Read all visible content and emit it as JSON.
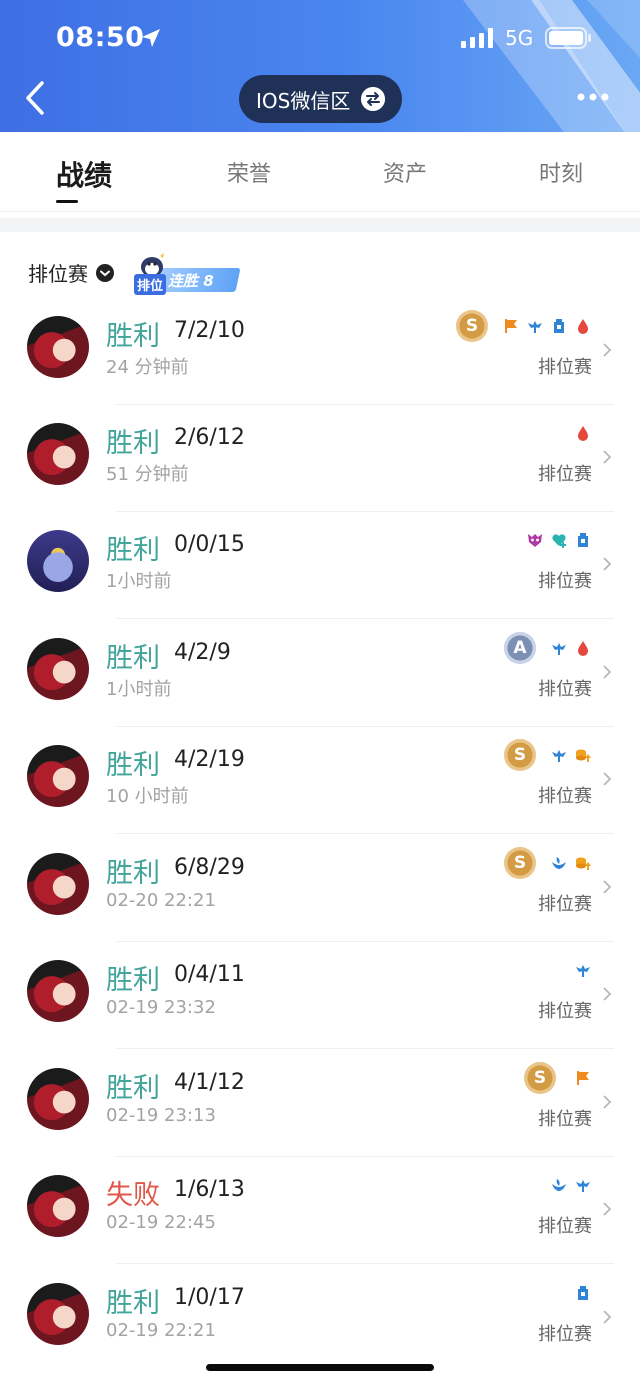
{
  "status_bar": {
    "time": "08:50",
    "network": "5G"
  },
  "nav": {
    "server_label": "IOS微信区"
  },
  "tabs": [
    {
      "label": "战绩",
      "active": true
    },
    {
      "label": "荣誉",
      "active": false
    },
    {
      "label": "资产",
      "active": false
    },
    {
      "label": "时刻",
      "active": false
    }
  ],
  "section": {
    "title": "排位赛",
    "badge_rank": "排位",
    "badge_streak": "连胜 8"
  },
  "matches": [
    {
      "result": "胜利",
      "kda": "7/2/10",
      "time": "24 分钟前",
      "mode": "排位赛"
    },
    {
      "result": "胜利",
      "kda": "2/6/12",
      "time": "51 分钟前",
      "mode": "排位赛"
    },
    {
      "result": "胜利",
      "kda": "0/0/15",
      "time": "1小时前",
      "mode": "排位赛"
    },
    {
      "result": "胜利",
      "kda": "4/2/9",
      "time": "1小时前",
      "mode": "排位赛"
    },
    {
      "result": "胜利",
      "kda": "4/2/19",
      "time": "10 小时前",
      "mode": "排位赛"
    },
    {
      "result": "胜利",
      "kda": "6/8/29",
      "time": "02-20 22:21",
      "mode": "排位赛"
    },
    {
      "result": "胜利",
      "kda": "0/4/11",
      "time": "02-19 23:32",
      "mode": "排位赛"
    },
    {
      "result": "胜利",
      "kda": "4/1/12",
      "time": "02-19 23:13",
      "mode": "排位赛"
    },
    {
      "result": "失败",
      "kda": "1/6/13",
      "time": "02-19 22:45",
      "mode": "排位赛"
    },
    {
      "result": "胜利",
      "kda": "1/0/17",
      "time": "02-19 22:21",
      "mode": "排位赛"
    }
  ],
  "medals": {
    "gold": "S",
    "silver": "A"
  },
  "colors": {
    "win": "#42a59b",
    "lose": "#e0574a",
    "header": "#3e6fe4"
  }
}
